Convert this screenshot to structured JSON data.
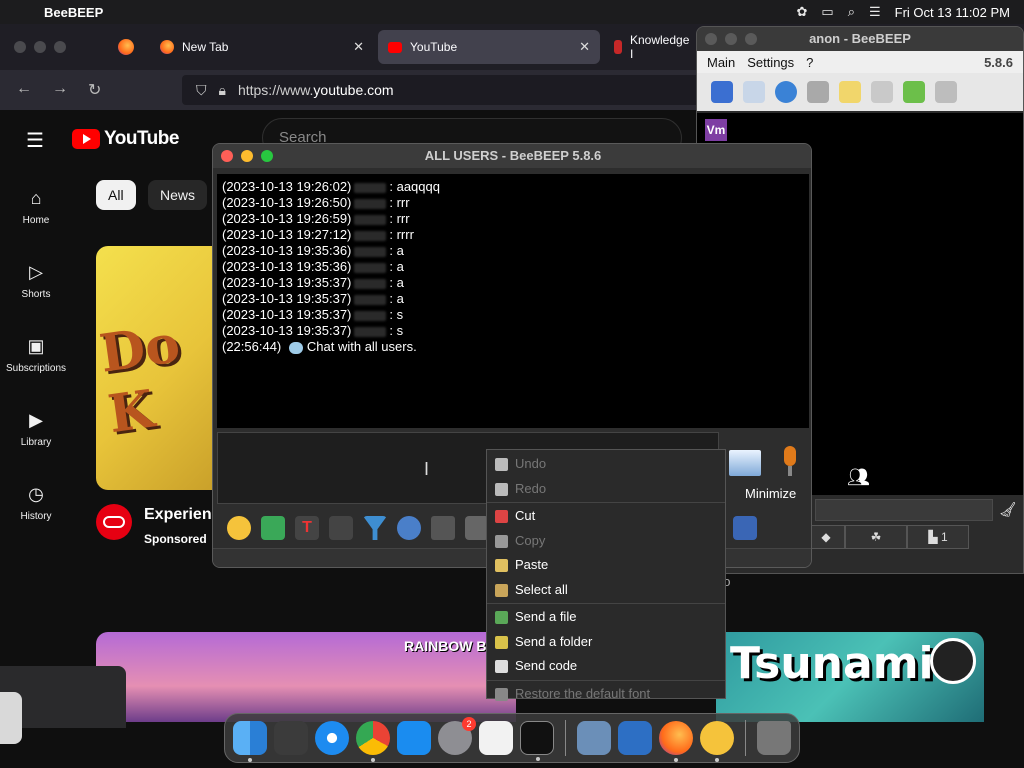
{
  "menubar": {
    "app_name": "BeeBEEP",
    "datetime": "Fri Oct 13  11:02 PM"
  },
  "firefox": {
    "tabs": [
      {
        "label": "New Tab"
      },
      {
        "label": "YouTube"
      },
      {
        "label": "Knowledge I"
      }
    ],
    "url": "https://www.youtube.com",
    "url_prefix": "https://www.",
    "url_domain": "youtube.com"
  },
  "youtube": {
    "logo_text": "YouTube",
    "search_placeholder": "Search",
    "sidebar": [
      {
        "label": "Home",
        "icon": "home-icon"
      },
      {
        "label": "Shorts",
        "icon": "shorts-icon"
      },
      {
        "label": "Subscriptions",
        "icon": "subscriptions-icon"
      },
      {
        "label": "Library",
        "icon": "library-icon"
      },
      {
        "label": "History",
        "icon": "history-icon"
      }
    ],
    "chips": [
      {
        "label": "All"
      },
      {
        "label": "News"
      }
    ],
    "video1": {
      "thumb_text": "Do K",
      "title": "Experienc",
      "sponsored": "Sponsored"
    },
    "ago_text": "go",
    "video2": {
      "thumb_text": "RAINBOW B"
    },
    "video3": {
      "thumb_text": "Tsunami"
    }
  },
  "beebeep_main": {
    "title": "anon - BeeBEEP",
    "menu": [
      "Main",
      "Settings",
      "?"
    ],
    "version": "5.8.6",
    "user_initials": "Vm",
    "group_count": "1"
  },
  "chat_window": {
    "title": "ALL USERS - BeeBEEP 5.8.6",
    "log": [
      {
        "ts": "(2023-10-13 19:26:02)",
        "msg": ": aaqqqq"
      },
      {
        "ts": "(2023-10-13 19:26:50)",
        "msg": ": rrr"
      },
      {
        "ts": "(2023-10-13 19:26:59)",
        "msg": ": rrr"
      },
      {
        "ts": "(2023-10-13 19:27:12)",
        "msg": ": rrrr"
      },
      {
        "ts": "(2023-10-13 19:35:36)",
        "msg": ": a"
      },
      {
        "ts": "(2023-10-13 19:35:36)",
        "msg": ": a"
      },
      {
        "ts": "(2023-10-13 19:35:37)",
        "msg": ": a"
      },
      {
        "ts": "(2023-10-13 19:35:37)",
        "msg": ": a"
      },
      {
        "ts": "(2023-10-13 19:35:37)",
        "msg": ": s"
      },
      {
        "ts": "(2023-10-13 19:35:37)",
        "msg": ": s"
      }
    ],
    "system_line": {
      "ts": "(22:56:44)",
      "msg": "Chat with all users."
    },
    "minimize_label": "Minimize"
  },
  "context_menu": {
    "items": [
      {
        "label": "Undo",
        "enabled": false,
        "icon": "undo-icon"
      },
      {
        "label": "Redo",
        "enabled": false,
        "icon": "redo-icon"
      },
      {
        "label": "Cut",
        "enabled": true,
        "icon": "cut-icon"
      },
      {
        "label": "Copy",
        "enabled": false,
        "icon": "copy-icon"
      },
      {
        "label": "Paste",
        "enabled": true,
        "icon": "paste-icon"
      },
      {
        "label": "Select all",
        "enabled": true,
        "icon": "select-all-icon"
      },
      {
        "label": "Send a file",
        "enabled": true,
        "icon": "send-file-icon"
      },
      {
        "label": "Send a folder",
        "enabled": true,
        "icon": "send-folder-icon"
      },
      {
        "label": "Send code",
        "enabled": true,
        "icon": "send-code-icon"
      },
      {
        "label": "Restore the default font",
        "enabled": false,
        "icon": "font-icon"
      }
    ]
  },
  "dock": {
    "system_settings_badge": "2"
  }
}
